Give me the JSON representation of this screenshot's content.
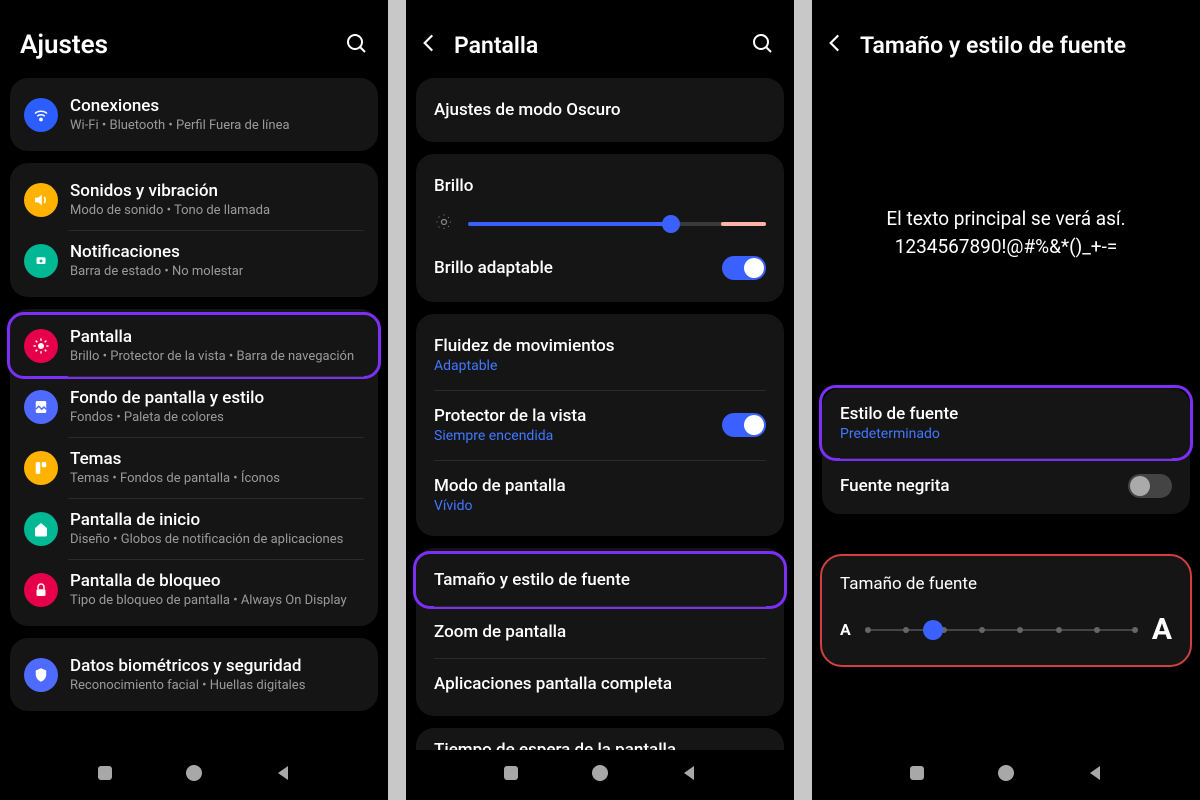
{
  "screen1": {
    "title": "Ajustes",
    "groups": [
      {
        "items": [
          {
            "icon": "wifi",
            "bg": "#2b5dff",
            "title": "Conexiones",
            "sub": "Wi-Fi  •  Bluetooth  •  Perfil Fuera de línea"
          }
        ]
      },
      {
        "items": [
          {
            "icon": "speaker",
            "bg": "#ffb300",
            "title": "Sonidos y vibración",
            "sub": "Modo de sonido  •  Tono de llamada"
          },
          {
            "icon": "bell",
            "bg": "#00b894",
            "title": "Notificaciones",
            "sub": "Barra de estado  •  No molestar"
          }
        ]
      },
      {
        "items": [
          {
            "icon": "sun",
            "bg": "#e6004c",
            "title": "Pantalla",
            "sub": "Brillo  •  Protector de la vista  •  Barra de navegación",
            "hl": true
          },
          {
            "icon": "wallpaper",
            "bg": "#4f6bff",
            "title": "Fondo de pantalla y estilo",
            "sub": "Fondos  •  Paleta de colores"
          },
          {
            "icon": "palette",
            "bg": "#ffb300",
            "title": "Temas",
            "sub": "Temas  •  Fondos de pantalla  •  Íconos"
          },
          {
            "icon": "home",
            "bg": "#00b894",
            "title": "Pantalla de inicio",
            "sub": "Diseño  •  Globos de notificación de aplicaciones"
          },
          {
            "icon": "lock",
            "bg": "#e6004c",
            "title": "Pantalla de bloqueo",
            "sub": "Tipo de bloqueo de pantalla  •  Always On Display"
          }
        ]
      },
      {
        "items": [
          {
            "icon": "shield",
            "bg": "#4f6bff",
            "title": "Datos biométricos y seguridad",
            "sub": "Reconocimiento facial  •  Huellas digitales"
          }
        ]
      }
    ]
  },
  "screen2": {
    "title": "Pantalla",
    "dark_mode": "Ajustes de modo Oscuro",
    "brightness_label": "Brillo",
    "brightness_pct": 68,
    "adaptive": "Brillo adaptable",
    "motion": {
      "title": "Fluidez de movimientos",
      "sub": "Adaptable"
    },
    "eye": {
      "title": "Protector de la vista",
      "sub": "Siempre encendida"
    },
    "mode": {
      "title": "Modo de pantalla",
      "sub": "Vívido"
    },
    "font": "Tamaño y estilo de fuente",
    "zoom": "Zoom de pantalla",
    "fullscreen": "Aplicaciones pantalla completa",
    "timeout": "Tiempo de espera de la pantalla"
  },
  "screen3": {
    "title": "Tamaño y estilo de fuente",
    "preview1": "El texto principal se verá así.",
    "preview2": "1234567890!@#%&*()_+-=",
    "style": {
      "title": "Estilo de fuente",
      "sub": "Predeterminado"
    },
    "bold": "Fuente negrita",
    "size_title": "Tamaño de fuente",
    "size_pos": 25
  }
}
